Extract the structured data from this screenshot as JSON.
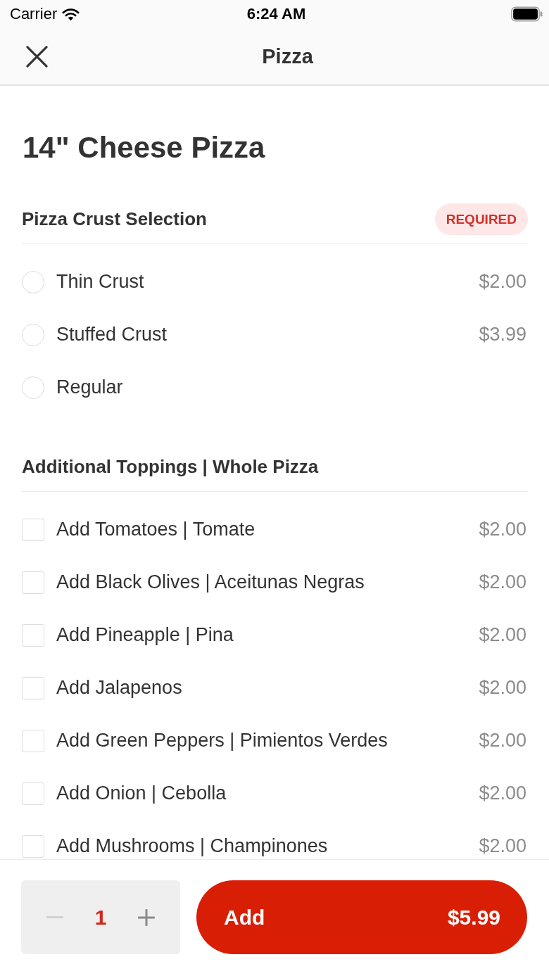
{
  "status_bar": {
    "carrier": "Carrier",
    "time": "6:24 AM"
  },
  "nav": {
    "title": "Pizza"
  },
  "item": {
    "title": "14\" Cheese Pizza"
  },
  "sections": [
    {
      "title": "Pizza Crust Selection",
      "badge": "REQUIRED",
      "kind": "radio",
      "options": [
        {
          "label": "Thin Crust",
          "price": "$2.00",
          "selected": false
        },
        {
          "label": "Stuffed Crust",
          "price": "$3.99",
          "selected": false
        },
        {
          "label": "Regular",
          "selected": false
        }
      ]
    },
    {
      "title": "Additional Toppings | Whole Pizza",
      "kind": "checkbox",
      "options": [
        {
          "label": "Add Tomatoes | Tomate",
          "price": "$2.00",
          "checked": false
        },
        {
          "label": "Add Black Olives | Aceitunas Negras",
          "price": "$2.00",
          "checked": false
        },
        {
          "label": "Add Pineapple | Pina",
          "price": "$2.00",
          "checked": false
        },
        {
          "label": "Add Jalapenos",
          "price": "$2.00",
          "checked": false
        },
        {
          "label": "Add Green Peppers | Pimientos Verdes",
          "price": "$2.00",
          "checked": false
        },
        {
          "label": "Add Onion | Cebolla",
          "price": "$2.00",
          "checked": false
        },
        {
          "label": "Add Mushrooms | Champinones",
          "price": "$2.00",
          "checked": false
        }
      ]
    }
  ],
  "footer": {
    "quantity": "1",
    "decrease_disabled": true,
    "add_button": {
      "label": "Add",
      "price": "$5.99"
    }
  }
}
